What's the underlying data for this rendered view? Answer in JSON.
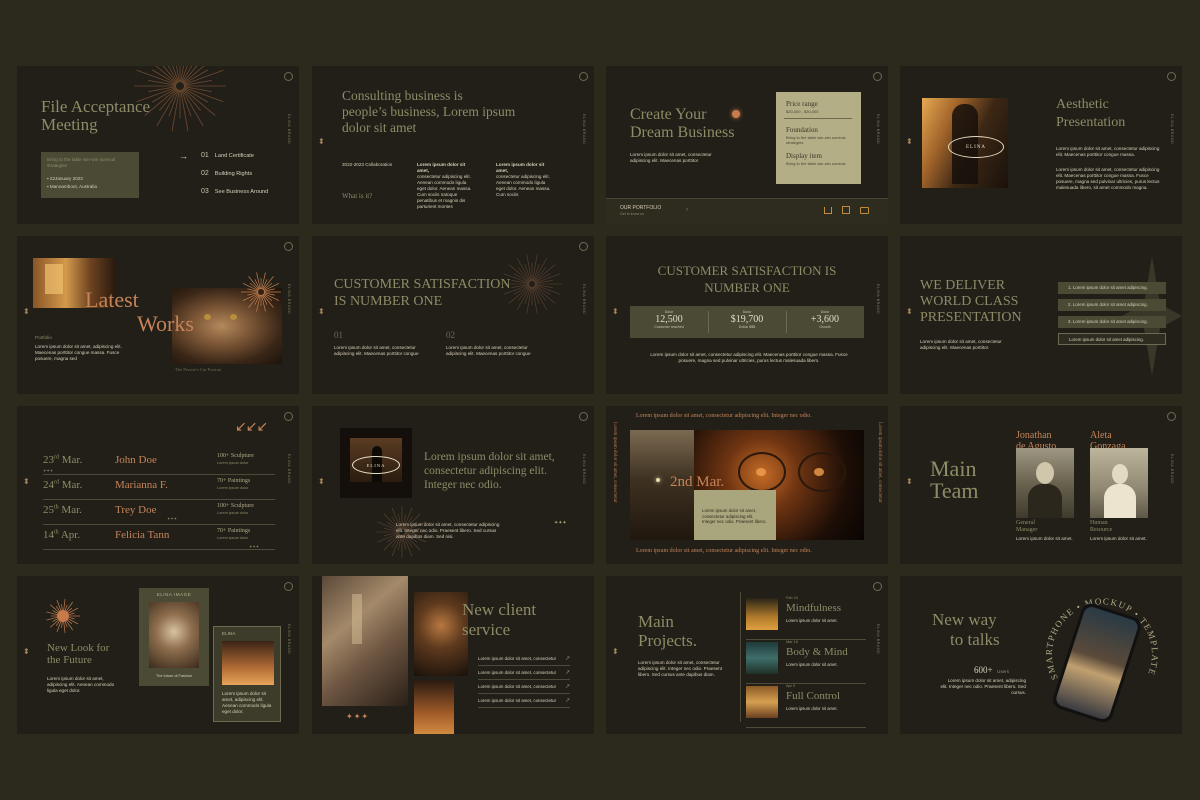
{
  "s1": {
    "title_l1": "File Acceptance",
    "title_l2": "Meeting",
    "box_text": "Bring to the table win-win survival strategies",
    "date": "22January 2023",
    "place": "Mannamboot, Australia",
    "items": [
      {
        "num": "01",
        "label": "Land Certificate"
      },
      {
        "num": "02",
        "label": "Building Rights"
      },
      {
        "num": "03",
        "label": "See Business Around"
      }
    ],
    "arrow": "→"
  },
  "s2": {
    "title_l1": "Consulting business is",
    "title_l2": "people’s business, Lorem ipsum",
    "title_l3": "dolor sit amet",
    "year": "2022-2023 Collaboration",
    "question": "What is it?",
    "col1_bold": "Lorem ipsum dolor sit amet,",
    "col1": "consectetur adipiscing elit. Aenean commodo ligula eget dolor. Aenean massa. Cum sociis natoque penatibus et magnis dis parturient montes",
    "col2_bold": "Lorem ipsum dolor sit amet,",
    "col2": "consectetur adipiscing elit. Aenean commodo ligula eget dolor. Aenean massa. Cum sociis"
  },
  "s3": {
    "title_l1": "Create Your",
    "title_l2": "Dream Business",
    "text": "Lorem ipsum dolor sit amet, consectetur adipiscing elit. Maecenas porttitor",
    "price_label": "Price range",
    "price_value": "$20,000 - $30,000",
    "foundation_label": "Foundation",
    "foundation_text": "Bring to the table win-win survival strategies",
    "display_label": "Display item",
    "display_text": "Bring to the table win-win survival",
    "portfolio": "OUR PORTFOLIO",
    "portfolio_sub": "Get to know us"
  },
  "s4": {
    "title_l1": "Aesthetic",
    "title_l2": "Presentation",
    "logo": "ELINA",
    "p1": "Lorem ipsum dolor sit amet, consectetur adipiscing elit. Maecenas porttitor congue massa.",
    "p2": "Lorem ipsum dolor sit amet, consectetur adipiscing elit. Maecenas porttitor congue massa. Fusce posuere, magna sed pulvinar ultricies, purus lectus malesuada libero, sit amet commodo magna."
  },
  "s5": {
    "title_l1": "Latest",
    "title_l2": "Works",
    "label": "Portfolio",
    "text": "Lorem ipsum dolor sit amet, adipiscing elit. Maecenas porttitor congue massa. Fusce posuere, magna sed",
    "caption": "The Person’s Cat Portrait"
  },
  "s6": {
    "title_l1": "CUSTOMER SATISFACTION",
    "title_l2": "IS NUMBER ONE",
    "n1": "01",
    "t1": "Lorem ipsum dolor sit amet, consectetur adipiscing elit. Maecenas porttitor congue",
    "n2": "02",
    "t2": "Lorem ipsum dolor sit amet, consectetur adipiscing elit. Maecenas porttitor congue"
  },
  "s7": {
    "title_l1": "CUSTOMER SATISFACTION IS",
    "title_l2": "NUMBER ONE",
    "stats": [
      {
        "top": "Dolor",
        "value": "12,500",
        "label": "Customer reached"
      },
      {
        "top": "Dolor",
        "value": "$19,700",
        "label": "Dollar $$$"
      },
      {
        "top": "Dolor",
        "value": "+3,600",
        "label": "Growth"
      }
    ],
    "text": "Lorem ipsum dolor sit amet, consectetur adipiscing elit. Maecenas porttitor congue massa. Fusce posuere, magna sed pulvinar ultricies, purus lectus malesuada libero."
  },
  "s8": {
    "title_l1": "WE DELIVER",
    "title_l2": "WORLD CLASS",
    "title_l3": "PRESENTATION",
    "text": "Lorem ipsum dolor sit amet, consectetur adipiscing elit. Maecenas porttitor.",
    "items": [
      {
        "num": "1.",
        "label": "Lorem ipsum dolor sit amet adipiscing."
      },
      {
        "num": "2.",
        "label": "Lorem ipsum dolor sit amet adipiscing."
      },
      {
        "num": "3.",
        "label": "Lorem ipsum dolor sit amet adipiscing."
      },
      {
        "num": "",
        "label": "Lorem ipsum dolor sit amet adipiscing."
      }
    ]
  },
  "s9": {
    "arrows": "↙↙↙",
    "rows": [
      {
        "day": "23",
        "sup": "rd",
        "month": "Mar.",
        "name": "John Doe",
        "count": "100+ Sculpture",
        "sub": "Lorem ipsum dolor"
      },
      {
        "day": "24",
        "sup": "rd",
        "month": "Mar.",
        "name": "Marianna F.",
        "count": "70+ Paintings",
        "sub": "Lorem ipsum dolor"
      },
      {
        "day": "25",
        "sup": "th",
        "month": "Mar.",
        "name": "Trey Doe",
        "count": "100+ Sculpture",
        "sub": "Lorem ipsum dolor"
      },
      {
        "day": "14",
        "sup": "th",
        "month": "Apr.",
        "name": "Felicia Tann",
        "count": "70+ Paintings",
        "sub": "Lorem ipsum dolor"
      }
    ],
    "dots": "✦✦✦"
  },
  "s10": {
    "logo": "ELINA",
    "title_l1": "Lorem ipsum dolor sit amet,",
    "title_l2": "consectetur adipiscing elit.",
    "title_l3": "Integer nec odio.",
    "text": "Lorem ipsum dolor sit amet, consectetur adipiscing elit. Integer nec odio. Praesent libero. Sed cursus ante dapibus diam. Sed nisi.",
    "dots": "✦✦✦"
  },
  "s11": {
    "top": "Lorem ipsum dolor sit amet, consectetur adipiscing elit. Integer nec odio.",
    "bottom": "Lorem ipsum dolor sit amet, consectetur adipiscing elit. Integer nec odio.",
    "left_vert": "Lorem ipsum dolor sit amet, consectetur",
    "right_vert": "Lorem ipsum dolor sit amet, consectetur",
    "date": "2nd Mar.",
    "box_text": "Lorem ipsum dolor sit amet, consectetur adipiscing elit. Integer nec odio. Praesent libero."
  },
  "s12": {
    "title_l1": "Main",
    "title_l2": "Team",
    "p1_name_l1": "Jonathan",
    "p1_name_l2": "de Agusto",
    "p1_role_l1": "General",
    "p1_role_l2": "Manager",
    "p1_text": "Lorem ipsum dolor sit amet.",
    "p2_name_l1": "Aleta",
    "p2_name_l2": "Gonzaga",
    "p2_role_l1": "Human",
    "p2_role_l2": "Resource",
    "p2_text": "Lorem ipsum dolor sit amet."
  },
  "s13": {
    "title_l1": "New Look for",
    "title_l2": "the Future",
    "text": "Lorem ipsum dolor sit amet, adipiscing elit. Aenean commodo ligula eget dolor.",
    "card1_label": "ELINA IMAGE",
    "card1_caption": "The future of Fashion",
    "card2_label": "ELINA",
    "card2_text": "Lorem ipsum dolor sit amet, adipiscing elit. Aenean commodo ligula eget dolor."
  },
  "s14": {
    "title_l1": "New client",
    "title_l2": "service",
    "items": [
      "Lorem ipsum dolor sit amet, consectetur",
      "Lorem ipsum dolor sit amet, consectetur",
      "Lorem ipsum dolor sit amet, consectetur",
      "Lorem ipsum dolor sit amet, consectetur"
    ],
    "arrow": "↗",
    "dots": "✦✦✦"
  },
  "s15": {
    "title_l1": "Main",
    "title_l2": "Projects.",
    "text": "Lorem ipsum dolor sit amet, consectetur adipiscing elit. Integer nec odio. Praesent libero. Sed cursus ante dapibus diam.",
    "projects": [
      {
        "date": "Feb 24",
        "name": "Mindfulness",
        "text": "Lorem ipsum dolor sit amet."
      },
      {
        "date": "Mar 16",
        "name": "Body & Mind",
        "text": "Lorem ipsum dolor sit amet."
      },
      {
        "date": "Apr 9",
        "name": "Full Control",
        "text": "Lorem ipsum dolor sit amet."
      }
    ]
  },
  "s16": {
    "title_l1": "New way",
    "title_l2": "to talks",
    "count": "600+",
    "count_label": "Users",
    "text": "Lorem ipsum dolor sit amet, adipiscing elit. Integer nec odio. Praesent libero. Sed cursus.",
    "arc": "SMARTPHONE • MOCKUP • TEMPLATE"
  },
  "common": {
    "side_label": "ELINA BRAND"
  }
}
